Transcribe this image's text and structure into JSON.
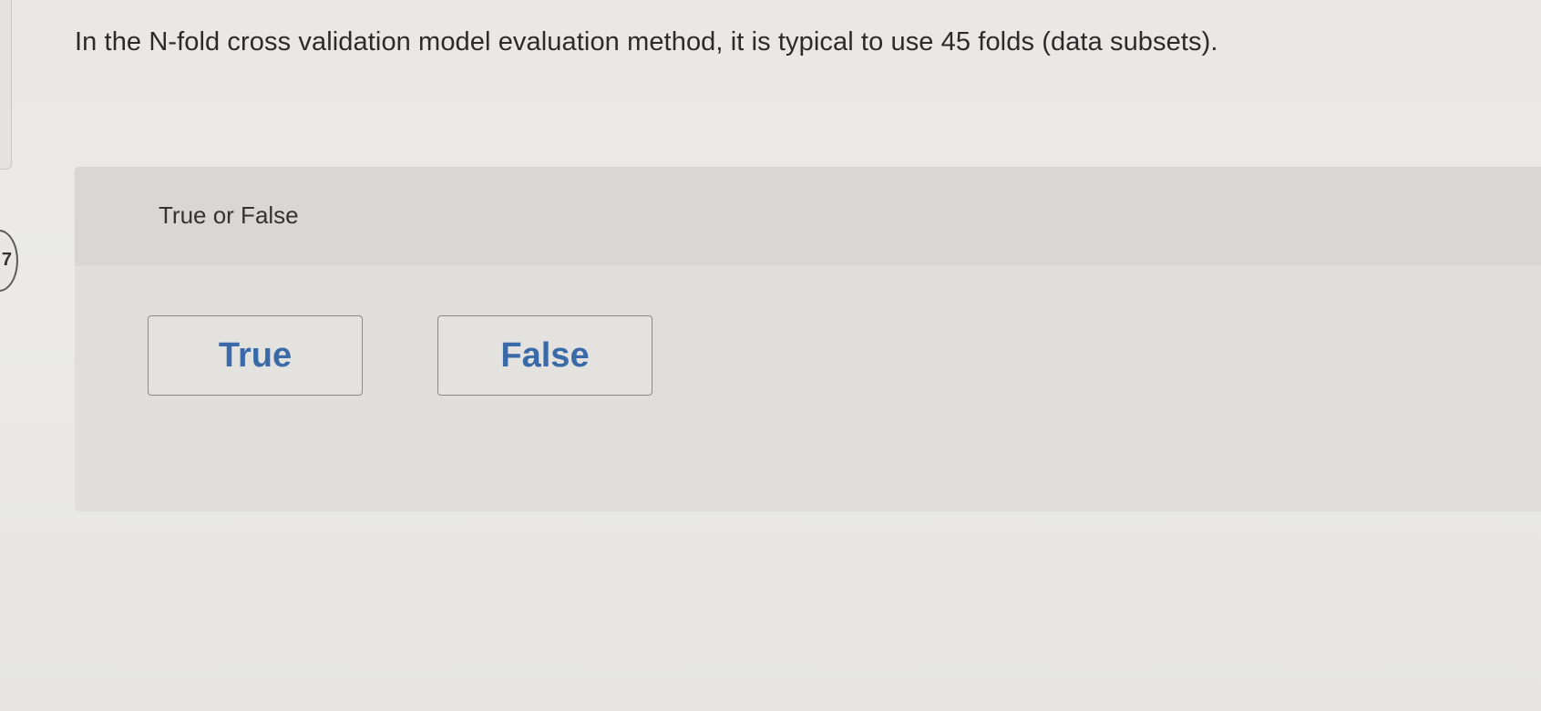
{
  "question": {
    "number": "7",
    "prompt": "In the N-fold cross validation model evaluation method, it is typical to use 45 folds (data subsets).",
    "type_label": "True or False"
  },
  "choices": [
    {
      "label": "True"
    },
    {
      "label": "False"
    }
  ],
  "colors": {
    "choice_text": "#3b6aa8",
    "panel_bg": "#dfdedb",
    "page_bg": "#e9e8e4"
  }
}
